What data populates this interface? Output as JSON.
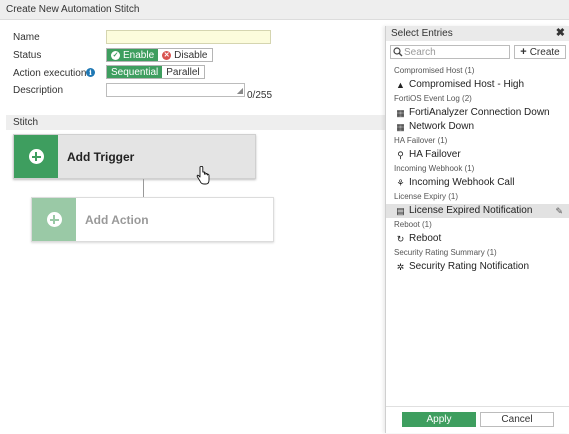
{
  "dialog": {
    "title": "Create New Automation Stitch"
  },
  "form": {
    "name_label": "Name",
    "name_value": "",
    "status_label": "Status",
    "status_options": [
      "Enable",
      "Disable"
    ],
    "status_selected": "Enable",
    "action_label": "Action execution",
    "action_options": [
      "Sequential",
      "Parallel"
    ],
    "action_selected": "Sequential",
    "description_label": "Description",
    "description_value": "",
    "description_count": "0/255"
  },
  "stitch": {
    "section_label": "Stitch",
    "trigger_label": "Add Trigger",
    "action_label": "Add Action"
  },
  "panel": {
    "title": "Select Entries",
    "search_placeholder": "Search",
    "create_label": "Create",
    "groups": [
      {
        "label": "Compromised Host (1)",
        "items": [
          {
            "label": "Compromised Host - High",
            "icon": "warning-icon"
          }
        ]
      },
      {
        "label": "FortiOS Event Log (2)",
        "items": [
          {
            "label": "FortiAnalyzer Connection Down",
            "icon": "log-icon"
          },
          {
            "label": "Network Down",
            "icon": "log-icon"
          }
        ]
      },
      {
        "label": "HA Failover (1)",
        "items": [
          {
            "label": "HA Failover",
            "icon": "sitemap-icon"
          }
        ]
      },
      {
        "label": "Incoming Webhook (1)",
        "items": [
          {
            "label": "Incoming Webhook Call",
            "icon": "webhook-icon"
          }
        ]
      },
      {
        "label": "License Expiry (1)",
        "items": [
          {
            "label": "License Expired Notification",
            "icon": "license-icon",
            "selected": true
          }
        ]
      },
      {
        "label": "Reboot (1)",
        "items": [
          {
            "label": "Reboot",
            "icon": "reboot-icon"
          }
        ]
      },
      {
        "label": "Security Rating Summary (1)",
        "items": [
          {
            "label": "Security Rating Notification",
            "icon": "rating-icon"
          }
        ]
      }
    ],
    "apply_label": "Apply",
    "cancel_label": "Cancel"
  },
  "colors": {
    "accent": "#3e9e5f",
    "name_bg": "#fcfcdc"
  }
}
